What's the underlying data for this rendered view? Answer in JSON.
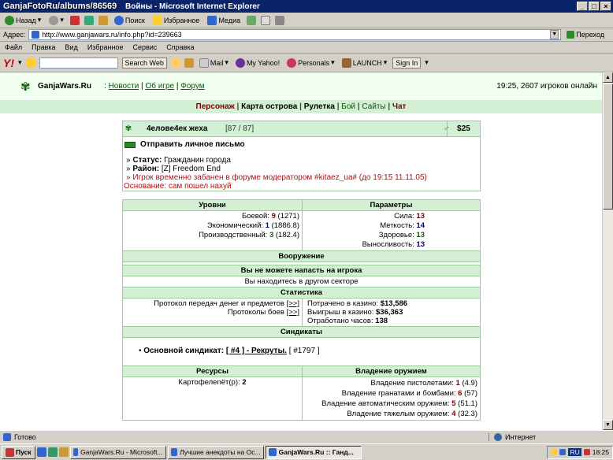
{
  "watermark": "GanjaFotoRu/albums/86569",
  "window": {
    "title": "Войны - Microsoft Internet Explorer",
    "controls": [
      "_",
      "□",
      "×"
    ]
  },
  "toolbar": {
    "back": "Назад",
    "search": "Поиск",
    "favorites": "Избранное",
    "media": "Медиа"
  },
  "address": {
    "label": "Адрес:",
    "url": "http://www.ganjawars.ru/info.php?id=239663",
    "go": "Переход"
  },
  "menu": [
    "Файл",
    "Правка",
    "Вид",
    "Избранное",
    "Сервис",
    "Справка"
  ],
  "yahoo": {
    "logo": "Y!",
    "search_btn": "Search Web",
    "mail": "Mail",
    "myyahoo": "My Yahoo!",
    "personals": "Personals",
    "launch": "LAUNCH",
    "signin": "Sign In"
  },
  "site": {
    "name": "GanjaWars.Ru",
    "links": [
      "Новости",
      "Об игре",
      "Форум"
    ],
    "status": "19:25, 2607 игроков онлайн",
    "subnav": [
      {
        "label": "Персонаж",
        "style": "r"
      },
      {
        "label": "Карта острова",
        "style": "b"
      },
      {
        "label": "Рулетка",
        "style": "b"
      },
      {
        "label": "Бой",
        "style": "g"
      },
      {
        "label": "Сайты",
        "style": "g"
      },
      {
        "label": "Чат",
        "style": "r"
      }
    ]
  },
  "player": {
    "name": "4елове4ек жеха",
    "hp": "[87 / 87]",
    "money": "$25",
    "pm": "Отправить личное письмо",
    "status_label": "Статус:",
    "status_value": "Гражданин города",
    "district_label": "Район:",
    "district_value": "[Z] Freedom End",
    "ban": "Игрок временно забанен в форуме модератором #kitaez_ua# (до 19:15 11.11.05)",
    "reason": "Основание: сам пошел нахуй"
  },
  "levels": {
    "header": "Уровни",
    "rows": [
      {
        "label": "Боевой:",
        "value": "9",
        "extra": "(1271)",
        "color": "r"
      },
      {
        "label": "Экономический:",
        "value": "1",
        "extra": "(1886.8)",
        "color": "b"
      },
      {
        "label": "Производственный:",
        "value": "3",
        "extra": "(182.4)",
        "color": "g"
      }
    ]
  },
  "params": {
    "header": "Параметры",
    "rows": [
      {
        "label": "Сила:",
        "value": "13",
        "color": "r"
      },
      {
        "label": "Меткость:",
        "value": "14",
        "color": "b"
      },
      {
        "label": "Здоровье:",
        "value": "13",
        "color": "g"
      },
      {
        "label": "Выносливость:",
        "value": "13",
        "color": "b"
      }
    ]
  },
  "weapons_header": "Вооружение",
  "attack_header": "Вы не можете напасть на игрока",
  "attack_note": "Вы находитесь в другом секторе",
  "stats": {
    "header": "Статистика",
    "left": [
      {
        "label": "Протокол передач денег и предметов",
        "link": "[>>]"
      },
      {
        "label": "Протоколы боев",
        "link": "[>>]"
      }
    ],
    "right": [
      {
        "label": "Потрачено в казино:",
        "value": "$13,586"
      },
      {
        "label": "Выигрыш в казино:",
        "value": "$36,363"
      },
      {
        "label": "Отработано часов:",
        "value": "138"
      }
    ]
  },
  "syndicates": {
    "header": "Синдикаты",
    "label": "Основной синдикат:",
    "link": "[ #4 ] - Рекруты.",
    "id": "[ #1797 ]"
  },
  "resources": {
    "header": "Ресурсы",
    "item": "Картофелеnёт(р):",
    "value": "2"
  },
  "skills": {
    "header": "Владение оружием",
    "rows": [
      {
        "label": "Владение пистолетами:",
        "value": "1",
        "extra": "(4.9)"
      },
      {
        "label": "Владение гранатами и бомбами:",
        "value": "6",
        "extra": "(57)"
      },
      {
        "label": "Владение автоматическим оружием:",
        "value": "5",
        "extra": "(51.1)"
      },
      {
        "label": "Владение тяжелым оружием:",
        "value": "4",
        "extra": "(32.3)"
      }
    ]
  },
  "statusbar": {
    "left": "Готово",
    "right": "Интернет"
  },
  "taskbar": {
    "start": "Пуск",
    "tasks": [
      "GanjaWars.Ru - Microsoft...",
      "Лучшие анекдоты на Ос...",
      "GanjaWars.Ru :: Ганд..."
    ],
    "tray": "RU",
    "clock": "18:25"
  }
}
